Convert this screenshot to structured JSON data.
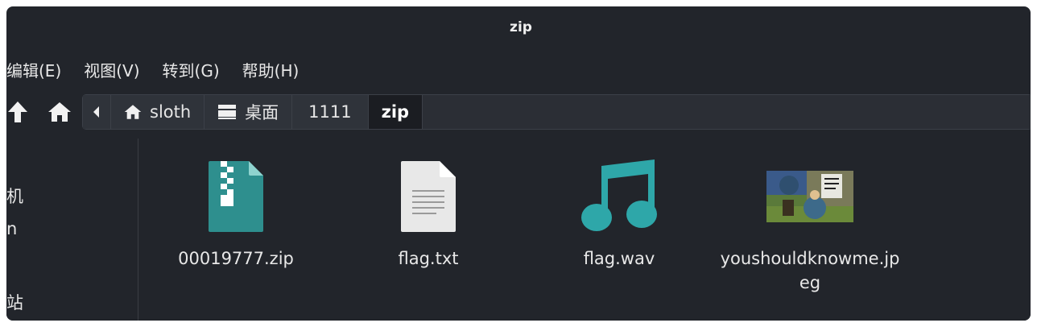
{
  "window": {
    "title": "zip"
  },
  "menubar": {
    "items": [
      {
        "label": "编辑(E)"
      },
      {
        "label": "视图(V)"
      },
      {
        "label": "转到(G)"
      },
      {
        "label": "帮助(H)"
      }
    ]
  },
  "toolbar": {
    "up_icon": "arrow-up-icon",
    "home_icon": "home-icon",
    "breadcrumbs": [
      {
        "label": "sloth",
        "icon": "home-icon"
      },
      {
        "label": "桌面",
        "icon": "desktop-icon"
      },
      {
        "label": "1111"
      },
      {
        "label": "zip",
        "active": true
      }
    ]
  },
  "sidebar": {
    "items": [
      {
        "label": "机"
      },
      {
        "label": "n"
      },
      {
        "label": "站"
      }
    ]
  },
  "files": [
    {
      "name": "00019777.zip",
      "icon": "zip-archive-icon"
    },
    {
      "name": "flag.txt",
      "icon": "text-file-icon"
    },
    {
      "name": "flag.wav",
      "icon": "music-note-icon"
    },
    {
      "name": "youshouldknowme.jpeg",
      "icon": "image-thumbnail"
    }
  ],
  "colors": {
    "background": "#22252b",
    "accent_teal": "#2ea7a9",
    "archive_teal": "#2e8f8e"
  }
}
